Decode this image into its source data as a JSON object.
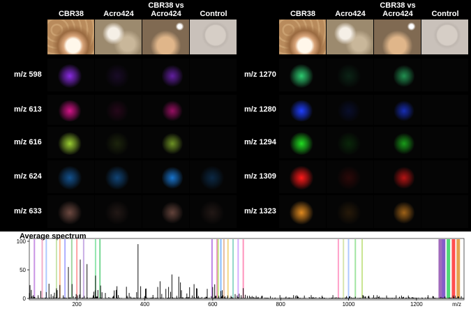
{
  "columns": [
    "CBR38",
    "Acro424",
    "CBR38 vs\nAcro424",
    "Control"
  ],
  "left_rows": [
    "m/z 598",
    "m/z 613",
    "m/z 616",
    "m/z 624",
    "m/z 633"
  ],
  "right_rows": [
    "m/z 1270",
    "m/z 1280",
    "m/z 1294",
    "m/z 1309",
    "m/z 1323"
  ],
  "left_colors": [
    "#8a2be2",
    "#d4148a",
    "#9acd32",
    "#1e90ff",
    "#c08070"
  ],
  "right_colors": [
    "#2ecc71",
    "#1f3fff",
    "#22dd22",
    "#ff1a1a",
    "#e08a20"
  ],
  "spectrum": {
    "title": "Average spectrum",
    "x_unit": "m/z",
    "x_ticks": [
      "200",
      "400",
      "600",
      "800",
      "1000",
      "1200"
    ],
    "y_ticks": [
      "100",
      "50",
      "0"
    ]
  }
}
